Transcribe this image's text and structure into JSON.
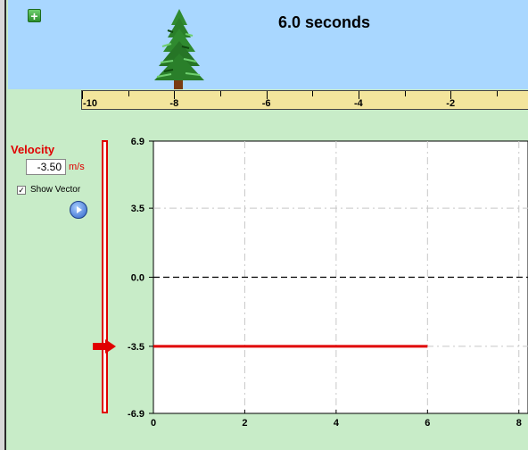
{
  "header": {
    "time_display": "6.0 seconds",
    "add_button_glyph": "+",
    "add_button_icon": "plus-icon"
  },
  "ruler": {
    "ticks": [
      "-10",
      "-8",
      "-6",
      "-4",
      "-2"
    ],
    "range": [
      -10,
      -0.3
    ]
  },
  "velocity_panel": {
    "title": "Velocity",
    "value": "-3.50",
    "unit": "m/s",
    "show_vector_label": "Show Vector",
    "show_vector_checked": true,
    "check_glyph": "✓",
    "play_icon": "play-icon",
    "slider_value": -3.5
  },
  "chart_data": {
    "type": "line",
    "y_tick_labels": [
      "6.9",
      "3.5",
      "0.0",
      "-3.5",
      "-6.9"
    ],
    "x_tick_labels": [
      "0",
      "2",
      "4",
      "6",
      "8"
    ],
    "ylim": [
      -6.9,
      6.9
    ],
    "xlim": [
      0,
      8.2
    ],
    "grid": true,
    "series": [
      {
        "x": [
          0,
          6
        ],
        "y": [
          -3.5,
          -3.5
        ],
        "color": "#e00000"
      }
    ],
    "zero_line_color": "#000000"
  },
  "colors": {
    "accent": "#e00000",
    "sky": "#a9d7ff",
    "background": "#c8ecc8",
    "ruler": "#f3e59c"
  }
}
